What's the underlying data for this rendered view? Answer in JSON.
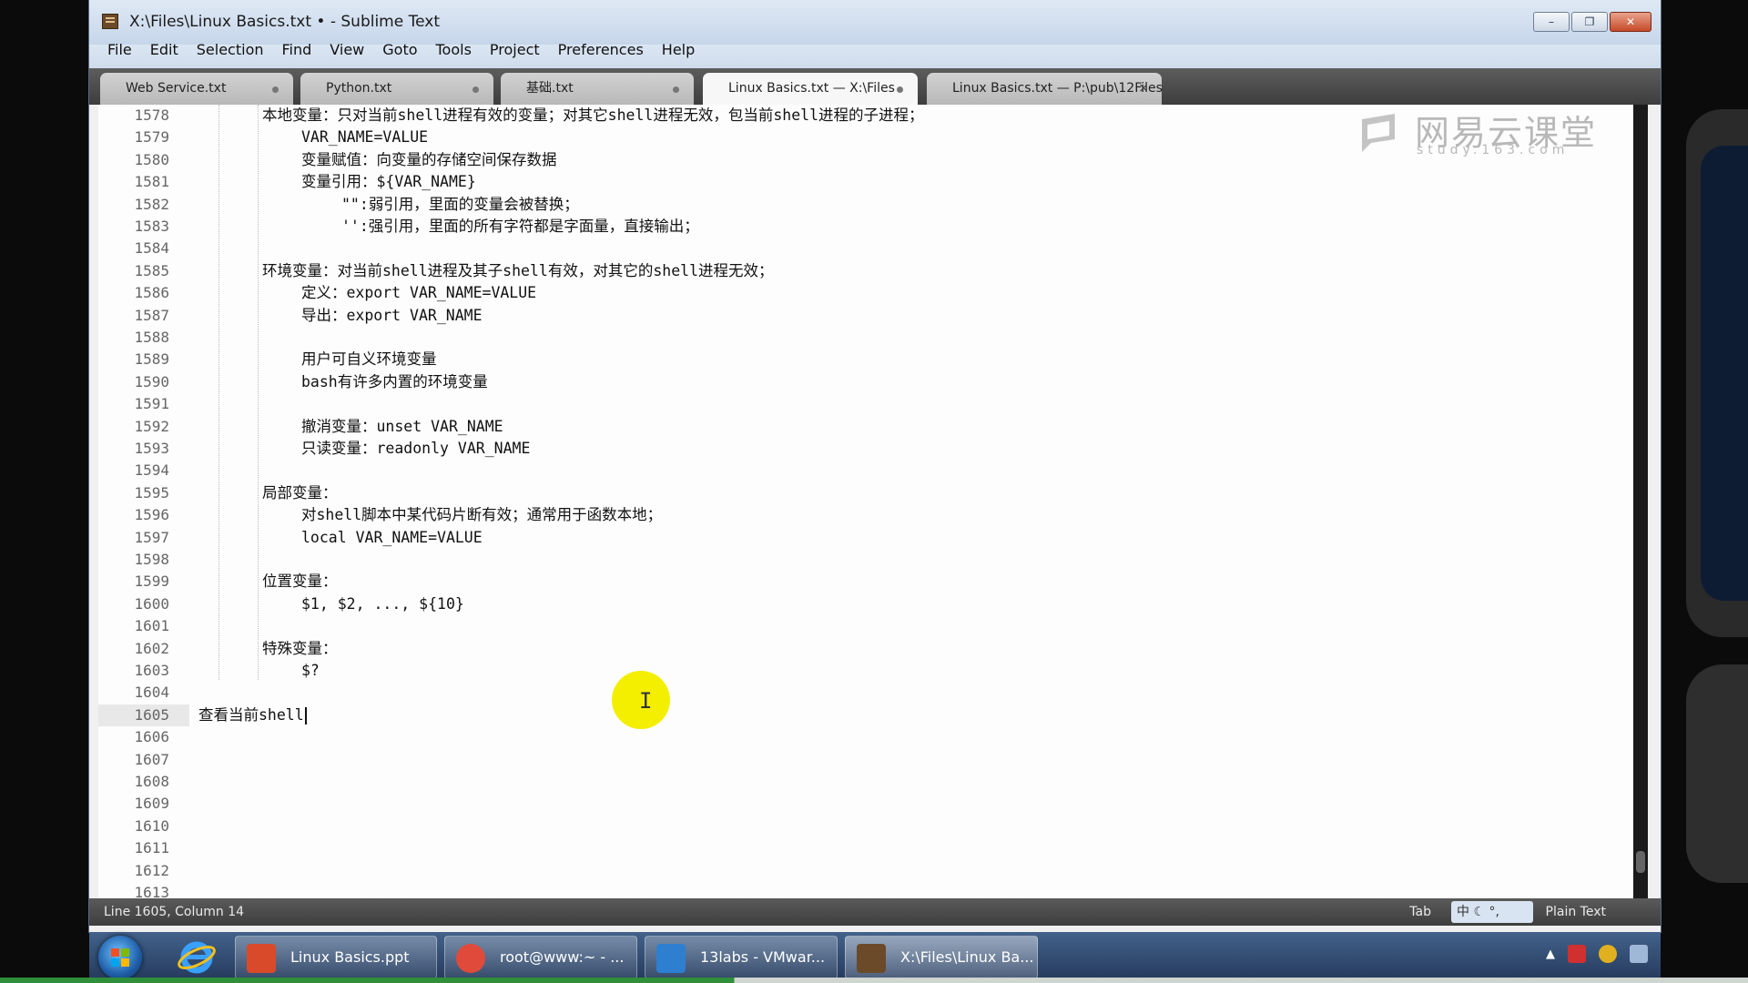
{
  "window": {
    "title": "X:\\Files\\Linux Basics.txt • - Sublime Text",
    "minimize": "–",
    "restore": "❐",
    "close": "✕"
  },
  "menu": [
    "File",
    "Edit",
    "Selection",
    "Find",
    "View",
    "Goto",
    "Tools",
    "Project",
    "Preferences",
    "Help"
  ],
  "tabs": [
    {
      "label": "Web Service.txt",
      "modified": true
    },
    {
      "label": "Python.txt",
      "modified": true
    },
    {
      "label": "基础.txt",
      "modified": true
    },
    {
      "label": "Linux Basics.txt — X:\\Files",
      "modified": true,
      "active": true
    },
    {
      "label": "Linux Basics.txt — P:\\pub\\12Files",
      "modified": false,
      "close": "×"
    }
  ],
  "watermark": {
    "title": "网易云课堂",
    "subtitle": "study.163.com"
  },
  "editor": {
    "current_line": 1605,
    "lines": [
      {
        "n": 1578,
        "indent": 2,
        "text": "本地变量：只对当前shell进程有效的变量；对其它shell进程无效，包当前shell进程的子进程；"
      },
      {
        "n": 1579,
        "indent": 3,
        "text": "VAR_NAME=VALUE"
      },
      {
        "n": 1580,
        "indent": 3,
        "text": "变量赋值：向变量的存储空间保存数据"
      },
      {
        "n": 1581,
        "indent": 3,
        "text": "变量引用：${VAR_NAME}"
      },
      {
        "n": 1582,
        "indent": 4,
        "text": "\"\":弱引用，里面的变量会被替换；"
      },
      {
        "n": 1583,
        "indent": 4,
        "text": "'':强引用，里面的所有字符都是字面量，直接输出；"
      },
      {
        "n": 1584,
        "indent": 0,
        "text": ""
      },
      {
        "n": 1585,
        "indent": 2,
        "text": "环境变量：对当前shell进程及其子shell有效，对其它的shell进程无效；"
      },
      {
        "n": 1586,
        "indent": 3,
        "text": "定义：export VAR_NAME=VALUE"
      },
      {
        "n": 1587,
        "indent": 3,
        "text": "导出：export VAR_NAME"
      },
      {
        "n": 1588,
        "indent": 0,
        "text": ""
      },
      {
        "n": 1589,
        "indent": 3,
        "text": "用户可自义环境变量"
      },
      {
        "n": 1590,
        "indent": 3,
        "text": "bash有许多内置的环境变量"
      },
      {
        "n": 1591,
        "indent": 0,
        "text": ""
      },
      {
        "n": 1592,
        "indent": 3,
        "text": "撤消变量：unset VAR_NAME"
      },
      {
        "n": 1593,
        "indent": 3,
        "text": "只读变量：readonly VAR_NAME"
      },
      {
        "n": 1594,
        "indent": 0,
        "text": ""
      },
      {
        "n": 1595,
        "indent": 2,
        "text": "局部变量："
      },
      {
        "n": 1596,
        "indent": 3,
        "text": "对shell脚本中某代码片断有效；通常用于函数本地；"
      },
      {
        "n": 1597,
        "indent": 3,
        "text": "local VAR_NAME=VALUE"
      },
      {
        "n": 1598,
        "indent": 0,
        "text": ""
      },
      {
        "n": 1599,
        "indent": 2,
        "text": "位置变量："
      },
      {
        "n": 1600,
        "indent": 3,
        "text": "$1, $2, ..., ${10}"
      },
      {
        "n": 1601,
        "indent": 0,
        "text": ""
      },
      {
        "n": 1602,
        "indent": 2,
        "text": "特殊变量："
      },
      {
        "n": 1603,
        "indent": 3,
        "text": "$?"
      },
      {
        "n": 1604,
        "indent": 0,
        "text": ""
      },
      {
        "n": 1605,
        "indent": 0,
        "text": "查看当前shell",
        "cursor": true
      },
      {
        "n": 1606,
        "indent": 0,
        "text": ""
      },
      {
        "n": 1607,
        "indent": 0,
        "text": ""
      },
      {
        "n": 1608,
        "indent": 0,
        "text": ""
      },
      {
        "n": 1609,
        "indent": 0,
        "text": ""
      },
      {
        "n": 1610,
        "indent": 0,
        "text": ""
      },
      {
        "n": 1611,
        "indent": 0,
        "text": ""
      },
      {
        "n": 1612,
        "indent": 0,
        "text": ""
      },
      {
        "n": 1613,
        "indent": 0,
        "text": ""
      }
    ]
  },
  "status": {
    "position": "Line 1605, Column 14",
    "indent": "Tab",
    "ime": "中 ☾ °,",
    "syntax": "Plain Text"
  },
  "taskbar": {
    "items": [
      {
        "label": "Linux Basics.ppt",
        "color": "#d94a2b"
      },
      {
        "label": "root@www:~ - ...",
        "color": "#e04a3a"
      },
      {
        "label": "13labs - VMwar...",
        "color": "#2f7fd0"
      },
      {
        "label": "X:\\Files\\Linux Ba...",
        "color": "#6b4a2a",
        "active": true
      }
    ],
    "tray_arrow": "▲"
  }
}
